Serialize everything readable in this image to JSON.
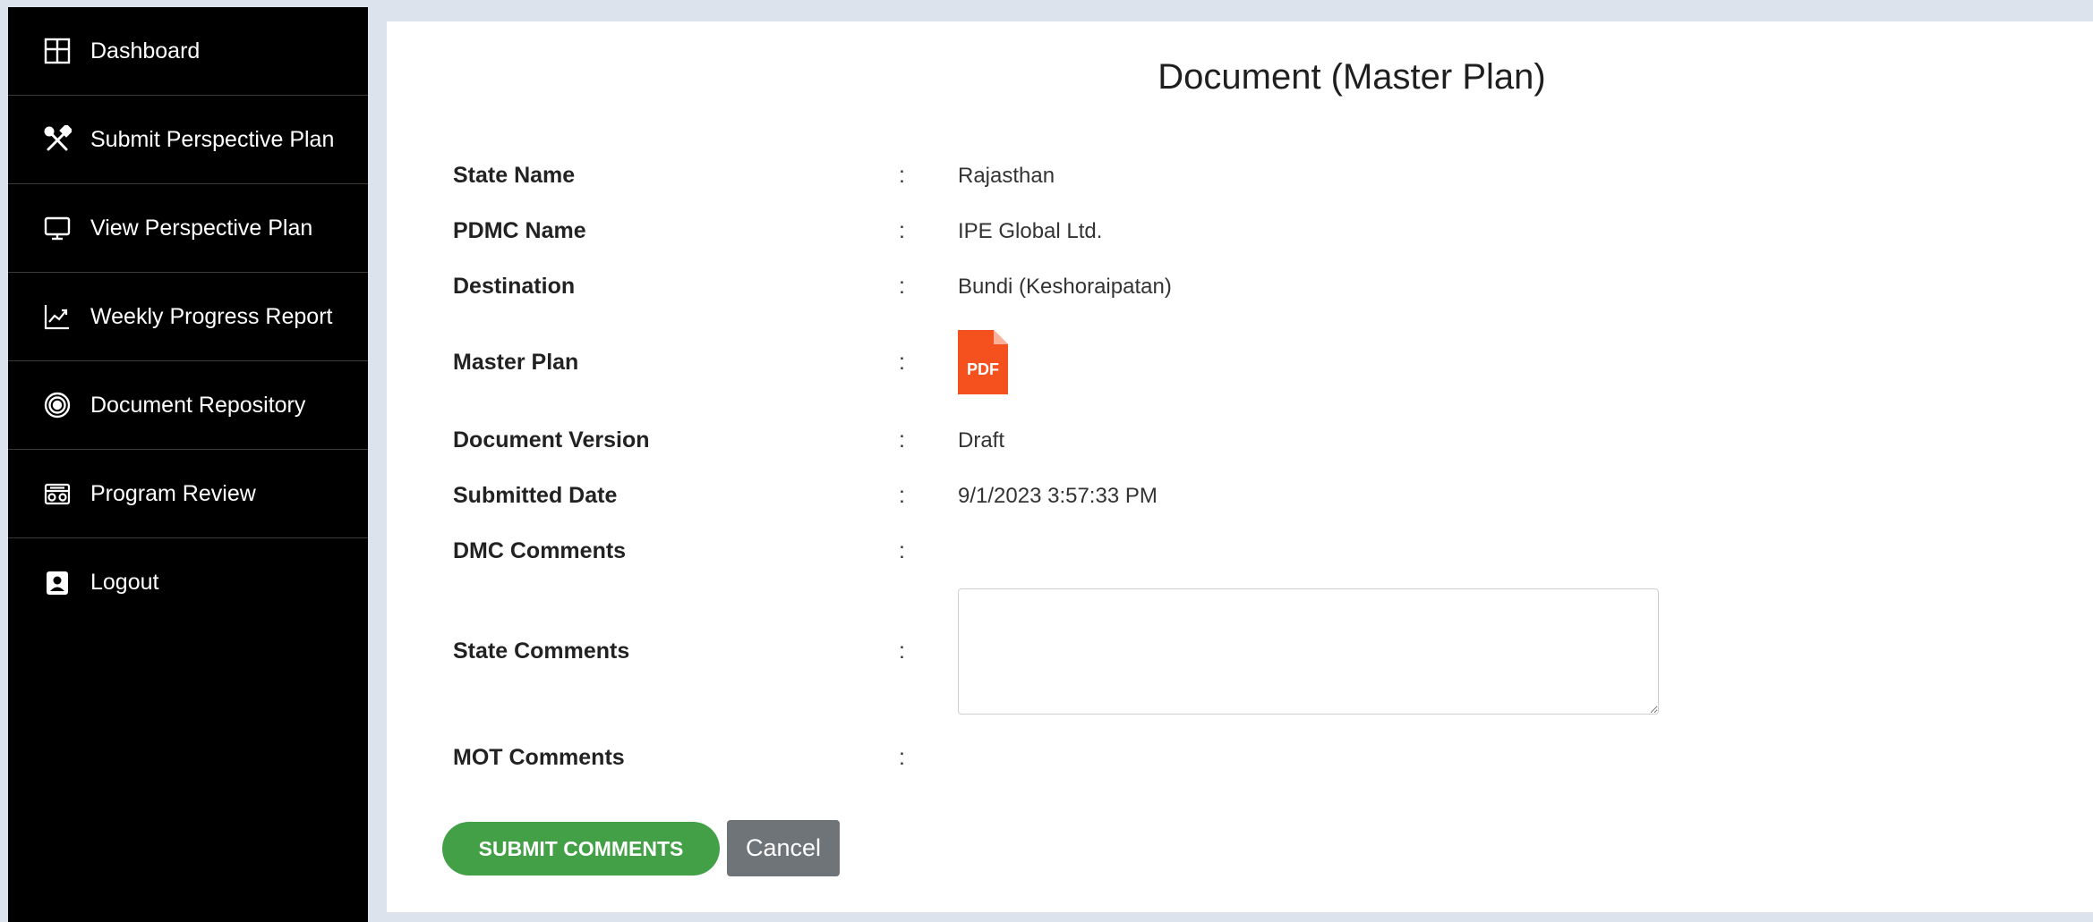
{
  "sidebar": {
    "items": [
      {
        "label": "Dashboard",
        "icon": "dashboard-icon"
      },
      {
        "label": "Submit Perspective Plan",
        "icon": "tools-icon"
      },
      {
        "label": "View Perspective Plan",
        "icon": "monitor-icon"
      },
      {
        "label": "Weekly Progress Report",
        "icon": "chart-line-icon"
      },
      {
        "label": "Document Repository",
        "icon": "target-icon"
      },
      {
        "label": "Program Review",
        "icon": "radio-icon"
      },
      {
        "label": "Logout",
        "icon": "user-badge-icon"
      }
    ]
  },
  "page": {
    "title": "Document (Master Plan)"
  },
  "fields": {
    "state_name": {
      "label": "State Name",
      "colon": ":",
      "value": "Rajasthan"
    },
    "pdmc_name": {
      "label": "PDMC Name",
      "colon": ":",
      "value": "IPE Global Ltd."
    },
    "destination": {
      "label": "Destination",
      "colon": ":",
      "value": "Bundi (Keshoraipatan)"
    },
    "master_plan": {
      "label": "Master Plan",
      "colon": ":",
      "file_icon": "pdf-icon",
      "file_icon_text": "PDF"
    },
    "document_version": {
      "label": "Document Version",
      "colon": ":",
      "value": "Draft"
    },
    "submitted_date": {
      "label": "Submitted Date",
      "colon": ":",
      "value": "9/1/2023 3:57:33 PM"
    },
    "dmc_comments": {
      "label": "DMC Comments",
      "colon": ":",
      "value": ""
    },
    "state_comments": {
      "label": "State Comments",
      "colon": ":",
      "value": "",
      "placeholder": ""
    },
    "mot_comments": {
      "label": "MOT Comments",
      "colon": ":",
      "value": ""
    }
  },
  "actions": {
    "submit_label": "SUBMIT COMMENTS",
    "cancel_label": "Cancel"
  },
  "colors": {
    "sidebar_bg": "#000000",
    "page_bg": "#dde3ec",
    "submit_bg": "#43a046",
    "cancel_bg": "#6f7478",
    "pdf_icon": "#f4511e"
  }
}
